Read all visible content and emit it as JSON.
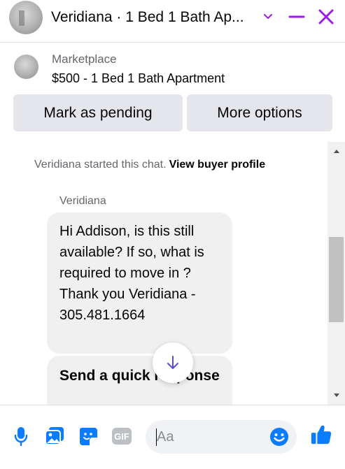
{
  "header": {
    "title": "Veridiana · 1 Bed 1 Bath Ap...",
    "icons": [
      "chevron-down-icon",
      "minimize-icon",
      "close-icon"
    ]
  },
  "listing": {
    "label": "Marketplace",
    "title": "$500 - 1 Bed 1 Bath Apartment",
    "mark_pending_label": "Mark as pending",
    "more_options_label": "More options"
  },
  "chat": {
    "started_text": "Veridiana started this chat.",
    "buyer_profile_link": "View buyer profile",
    "sender_name": "Veridiana",
    "messages": [
      "Hi Addison, is this still available? If so, what is required to move in ? Thank you Veridiana - 305.481.1664",
      "Send a quick response"
    ]
  },
  "composer": {
    "placeholder": "Aa",
    "value": "",
    "icons": [
      "microphone-icon",
      "photo-icon",
      "sticker-icon",
      "gif-icon",
      "emoji-icon",
      "thumbs-up-icon"
    ]
  },
  "colors": {
    "accent_purple": "#9b1de8",
    "accent_blue": "#0a7cff",
    "button_gray": "#e4e6eb",
    "bubble_gray": "#f0f0f0"
  }
}
